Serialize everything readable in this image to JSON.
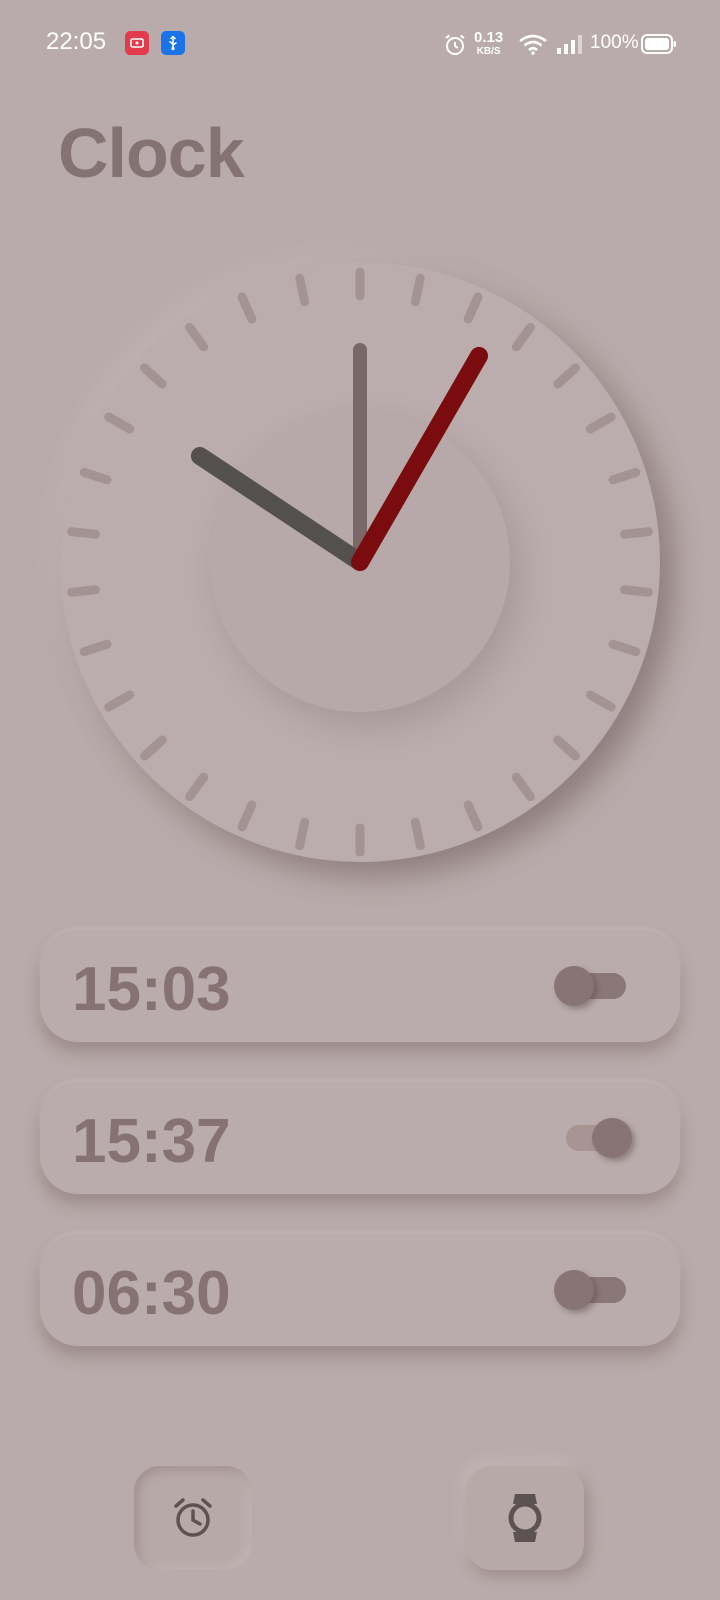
{
  "status_bar": {
    "time": "22:05",
    "notifications": [
      "screen-record-icon",
      "usb-icon"
    ],
    "alarm_icon": "alarm-icon",
    "net_speed_value": "0.13",
    "net_speed_unit": "KB/S",
    "wifi_icon": "wifi-icon",
    "signal_icon": "signal-icon",
    "battery_text": "100%",
    "battery_level": 1.0
  },
  "title": "Clock",
  "clock": {
    "hours": 22,
    "minutes": 5,
    "seconds": 5,
    "hand_colors": {
      "hour": "#555050",
      "minute": "#7a6868",
      "second": "#7a0b0e"
    }
  },
  "alarms": [
    {
      "time": "15:03",
      "enabled": false
    },
    {
      "time": "15:37",
      "enabled": true
    },
    {
      "time": "06:30",
      "enabled": false
    }
  ],
  "bottom_nav": {
    "items": [
      {
        "icon": "alarm-clock-icon",
        "active": true
      },
      {
        "icon": "watch-icon",
        "active": false
      }
    ]
  },
  "colors": {
    "background": "#b9abab",
    "text": "#867272",
    "accent": "#7a0b0e"
  }
}
